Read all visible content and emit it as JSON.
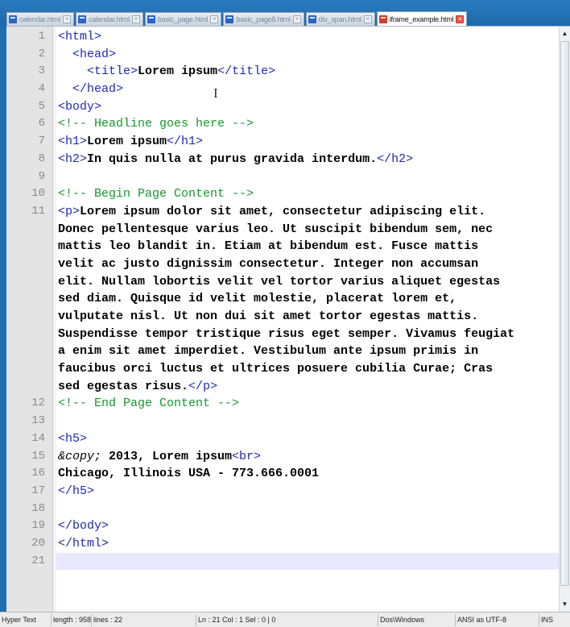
{
  "tabs": [
    {
      "label": "calendar.html",
      "active": false
    },
    {
      "label": "calendar.html",
      "active": false
    },
    {
      "label": "basic_page.html",
      "active": false
    },
    {
      "label": "basic_page8.html",
      "active": false
    },
    {
      "label": "div_span.html",
      "active": false
    },
    {
      "label": "iframe_example.html",
      "active": true
    }
  ],
  "editor": {
    "current_line": 21,
    "lines": [
      {
        "n": "1",
        "parts": [
          {
            "t": "tag",
            "v": "<html>"
          }
        ]
      },
      {
        "n": "2",
        "parts": [
          {
            "t": "tag",
            "v": "  <head>"
          }
        ]
      },
      {
        "n": "3",
        "parts": [
          {
            "t": "tag",
            "v": "    <title>"
          },
          {
            "t": "txt",
            "v": "Lorem ipsum"
          },
          {
            "t": "tag",
            "v": "</title>"
          }
        ]
      },
      {
        "n": "4",
        "parts": [
          {
            "t": "tag",
            "v": "  </head>"
          }
        ]
      },
      {
        "n": "5",
        "parts": [
          {
            "t": "tag",
            "v": "<body>"
          }
        ]
      },
      {
        "n": "6",
        "parts": [
          {
            "t": "cmt",
            "v": "<!-- Headline goes here -->"
          }
        ]
      },
      {
        "n": "7",
        "parts": [
          {
            "t": "tag",
            "v": "<h1>"
          },
          {
            "t": "txt",
            "v": "Lorem ipsum"
          },
          {
            "t": "tag",
            "v": "</h1>"
          }
        ]
      },
      {
        "n": "8",
        "parts": [
          {
            "t": "tag",
            "v": "<h2>"
          },
          {
            "t": "txt",
            "v": "In quis nulla at purus gravida interdum."
          },
          {
            "t": "tag",
            "v": "</h2>"
          }
        ]
      },
      {
        "n": "9",
        "parts": []
      },
      {
        "n": "10",
        "parts": [
          {
            "t": "cmt",
            "v": "<!-- Begin Page Content -->"
          }
        ]
      },
      {
        "n": "11",
        "parts": [
          {
            "t": "tag",
            "v": "<p>"
          },
          {
            "t": "txt",
            "v": "Lorem ipsum dolor sit amet, consectetur adipiscing elit."
          }
        ]
      },
      {
        "n": "",
        "parts": [
          {
            "t": "txt",
            "v": "Donec pellentesque varius leo. Ut suscipit bibendum sem, nec"
          }
        ]
      },
      {
        "n": "",
        "parts": [
          {
            "t": "txt",
            "v": "mattis leo blandit in. Etiam at bibendum est. Fusce mattis"
          }
        ]
      },
      {
        "n": "",
        "parts": [
          {
            "t": "txt",
            "v": "velit ac justo dignissim consectetur. Integer non accumsan"
          }
        ]
      },
      {
        "n": "",
        "parts": [
          {
            "t": "txt",
            "v": "elit. Nullam lobortis velit vel tortor varius aliquet egestas"
          }
        ]
      },
      {
        "n": "",
        "parts": [
          {
            "t": "txt",
            "v": "sed diam. Quisque id velit molestie, placerat lorem et,"
          }
        ]
      },
      {
        "n": "",
        "parts": [
          {
            "t": "txt",
            "v": "vulputate nisl. Ut non dui sit amet tortor egestas mattis."
          }
        ]
      },
      {
        "n": "",
        "parts": [
          {
            "t": "txt",
            "v": "Suspendisse tempor tristique risus eget semper. Vivamus feugiat"
          }
        ]
      },
      {
        "n": "",
        "parts": [
          {
            "t": "txt",
            "v": "a enim sit amet imperdiet. Vestibulum ante ipsum primis in"
          }
        ]
      },
      {
        "n": "",
        "parts": [
          {
            "t": "txt",
            "v": "faucibus orci luctus et ultrices posuere cubilia Curae; Cras"
          }
        ]
      },
      {
        "n": "",
        "parts": [
          {
            "t": "txt",
            "v": "sed egestas risus."
          },
          {
            "t": "tag",
            "v": "</p>"
          }
        ]
      },
      {
        "n": "12",
        "parts": [
          {
            "t": "cmt",
            "v": "<!-- End Page Content -->"
          }
        ]
      },
      {
        "n": "13",
        "parts": []
      },
      {
        "n": "14",
        "parts": [
          {
            "t": "tag",
            "v": "<h5>"
          }
        ]
      },
      {
        "n": "15",
        "parts": [
          {
            "t": "ent",
            "v": "&copy;"
          },
          {
            "t": "txt",
            "v": " 2013, Lorem ipsum"
          },
          {
            "t": "tag",
            "v": "<br>"
          }
        ]
      },
      {
        "n": "16",
        "parts": [
          {
            "t": "txt",
            "v": "Chicago, Illinois USA - 773.666.0001"
          }
        ]
      },
      {
        "n": "17",
        "parts": [
          {
            "t": "tag",
            "v": "</h5>"
          }
        ]
      },
      {
        "n": "18",
        "parts": []
      },
      {
        "n": "19",
        "parts": [
          {
            "t": "tag",
            "v": "</body>"
          }
        ]
      },
      {
        "n": "20",
        "parts": [
          {
            "t": "tag",
            "v": "</html>"
          }
        ]
      },
      {
        "n": "21",
        "parts": []
      }
    ]
  },
  "statusbar": {
    "filetype": "Hyper Text",
    "length": "length : 958",
    "lines": "lines : 22",
    "position": "Ln : 21   Col : 1   Sel : 0 | 0",
    "eol": "Dos\\Windows",
    "encoding": "ANSI as UTF-8",
    "mode": "INS"
  },
  "icons": {
    "tab_file": "html-file-icon",
    "tab_close": "close-icon",
    "scroll_up": "arrow-up-icon",
    "scroll_down": "arrow-down-icon",
    "cursor": "text-cursor-icon"
  },
  "colors": {
    "tag": "#1e2ab8",
    "comment": "#159a2c",
    "text": "#000000",
    "current_line": "#e8e8ff",
    "frame": "#1f6fb0"
  }
}
